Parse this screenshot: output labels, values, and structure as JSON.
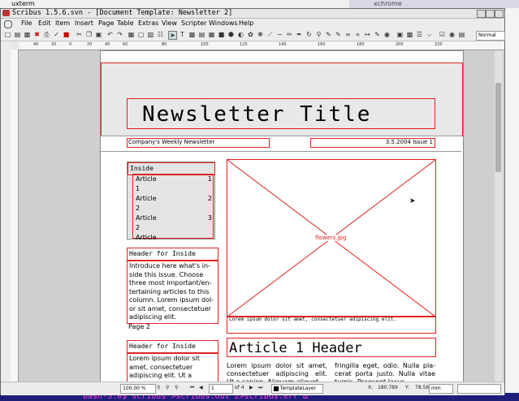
{
  "desktop": {
    "xterm_title": "uxterm",
    "right_top_text": "xchrome",
    "terminal_command": "bash-5.0$ scribus >scribus.out 2>scribus.err &"
  },
  "window": {
    "title": "Scribus 1.5.6.svn - [Document Template: Newsletter 2]"
  },
  "menu": [
    "File",
    "Edit",
    "Item",
    "Insert",
    "Page",
    "Table",
    "Extras",
    "View",
    "Scripter",
    "Windows",
    "Help"
  ],
  "toolbar": {
    "mode_select": "Normal"
  },
  "ruler_top": [
    "40",
    "20",
    "0",
    "20",
    "40",
    "60",
    "80",
    "100",
    "120",
    "140",
    "160",
    "180",
    "200",
    "220"
  ],
  "document": {
    "title": "Newsletter Title",
    "subtitle_left": "Company's Weekly Newsletter",
    "subtitle_right": "3.5.2004 Issue 1",
    "inside_heading": "Inside",
    "toc": [
      {
        "label": "Article",
        "num": "1"
      },
      {
        "label": "1",
        "num": ""
      },
      {
        "label": "Article",
        "num": "2"
      },
      {
        "label": "2",
        "num": ""
      },
      {
        "label": "Article",
        "num": "3"
      },
      {
        "label": "2",
        "num": ""
      },
      {
        "label": "Article",
        "num": "4"
      }
    ],
    "header_for_inside_1": "Header for Inside",
    "intro_text": "Introduce here what's in-side this issue. Choose three most important/en-tertaining articles to this column. Lorem ipsum dol-or sit amet, consectetuer adipiscing elit.",
    "page_label": "Page 2",
    "header_for_inside_2": "Header for Inside",
    "second_text": "Lorem ipsum dolor sit amet, consectetuer adipiscing elit. Ut a sapien. Aliquam aliquet purus molestie dolor.",
    "image_name": "flowers.jpg",
    "caption": "Lorem ipsum dolor sit amet, consectetuer adipiscing elit.",
    "article_header": "Article 1 Header",
    "article_col1": "Lorem ipsum dolor sit amet, consectetuer adipiscing elit. Ut a sapien. Aliquam aliquet",
    "article_col2": "fringilla eget, odio. Nulla pla-cerat porta justo. Nulla vitae turpis. Praesent lacus."
  },
  "status": {
    "zoom": "100.00 %",
    "page_current": "1",
    "page_total": "of 4",
    "layer": "TemplateLayer",
    "x_label": "X:",
    "x_value": "180.789",
    "y_label": "Y:",
    "y_value": "78.567",
    "unit": "mm"
  }
}
